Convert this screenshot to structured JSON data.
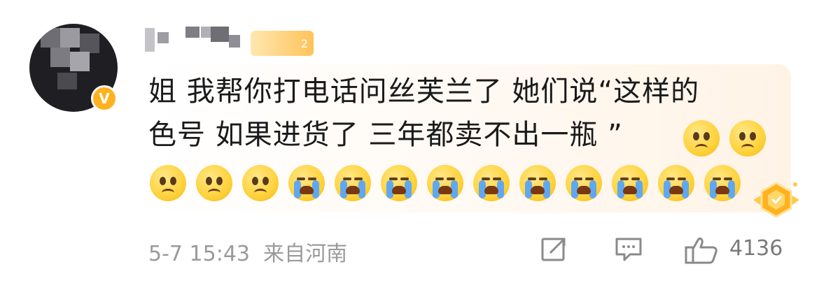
{
  "comment": {
    "text_line1": "姐 我帮你打电话问丝芙兰了 她们说“这样的",
    "text_line2": "色号 如果进货了 三年都卖不出一瓶 ”"
  },
  "user": {
    "verified_mark": "V",
    "level_badge": "2"
  },
  "footer": {
    "time": "5-7 15:43",
    "location": "来自河南",
    "like_count": "4136"
  },
  "emojis": {
    "line2": [
      "sad-face-icon",
      "sad-face-icon"
    ],
    "line3": [
      "sad-face-icon",
      "sad-face-icon",
      "sad-face-icon",
      "crying-face-icon",
      "crying-face-icon",
      "crying-face-icon",
      "crying-face-icon",
      "crying-face-icon",
      "crying-face-icon",
      "crying-face-icon",
      "crying-face-icon",
      "crying-face-icon",
      "crying-face-icon"
    ]
  },
  "colors": {
    "meta_gray": "#9a9a9a",
    "badge_orange": "#ffb21e"
  }
}
